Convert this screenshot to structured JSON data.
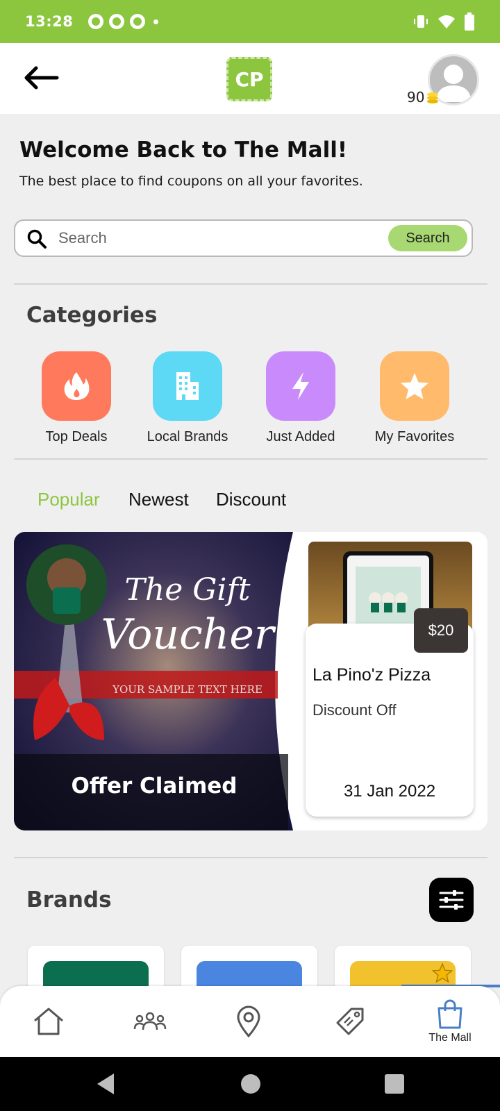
{
  "status_bar": {
    "time": "13:28",
    "notification_icons": [
      "cp-notification-icon",
      "app-notification-icon",
      "app-notification-icon"
    ],
    "right_icons": [
      "vibrate-icon",
      "wifi-icon",
      "battery-icon"
    ]
  },
  "header": {
    "logo_text": "CP",
    "coins": "90"
  },
  "welcome": {
    "title": "Welcome Back to The Mall!",
    "subtitle": "The best place to find coupons on all your favorites."
  },
  "search": {
    "placeholder": "Search",
    "value": "",
    "button_label": "Search"
  },
  "categories": {
    "title": "Categories",
    "items": [
      {
        "label": "Top Deals",
        "icon": "flame-icon",
        "color": "#ff7a5c"
      },
      {
        "label": "Local Brands",
        "icon": "building-icon",
        "color": "#5dd8f5"
      },
      {
        "label": "Just Added",
        "icon": "lightning-icon",
        "color": "#c98bfc"
      },
      {
        "label": "My Favorites",
        "icon": "star-icon",
        "color": "#ffbb6b"
      }
    ]
  },
  "tabs": [
    {
      "label": "Popular",
      "active": true
    },
    {
      "label": "Newest",
      "active": false
    },
    {
      "label": "Discount",
      "active": false
    }
  ],
  "deal": {
    "image_title_line1": "The Gift",
    "image_title_line2": "Voucher",
    "image_sample_text": "YOUR SAMPLE TEXT HERE",
    "status": "Offer Claimed",
    "price": "$20",
    "title": "La Pino'z Pizza",
    "subtitle": "Discount Off",
    "date": "31 Jan 2022"
  },
  "brands": {
    "title": "Brands",
    "cards": [
      {
        "color": "#0b6e4f"
      },
      {
        "color": "#4a86e0"
      },
      {
        "color": "#f2c12e",
        "favorite": true
      }
    ]
  },
  "bottom_nav": {
    "items": [
      {
        "icon": "home-icon",
        "label": ""
      },
      {
        "icon": "people-icon",
        "label": ""
      },
      {
        "icon": "location-pin-icon",
        "label": ""
      },
      {
        "icon": "tag-icon",
        "label": ""
      },
      {
        "icon": "shopping-bag-icon",
        "label": "The Mall",
        "active": true
      }
    ]
  },
  "colors": {
    "brand_green": "#8cc63f",
    "active_blue": "#4a7fc8"
  }
}
